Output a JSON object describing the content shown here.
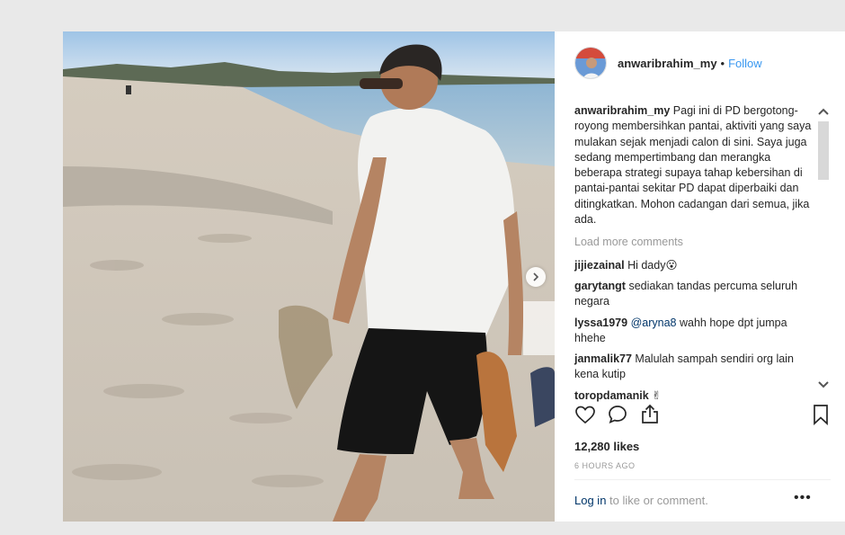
{
  "post": {
    "username": "anwaribrahim_my",
    "follow_label": "Follow",
    "separator": "•",
    "caption_user": "anwaribrahim_my",
    "caption_text": "Pagi ini di PD bergotong-royong membersihkan pantai, aktiviti yang saya mulakan sejak menjadi calon di sini. Saya juga sedang mempertimbang dan merangka beberapa strategi supaya tahap kebersihan di pantai-pantai sekitar PD dapat diperbaiki dan ditingkatkan. Mohon cadangan dari semua, jika ada.",
    "load_more": "Load more comments",
    "comments": [
      {
        "user": "jijiezainal",
        "text": "Hi dady😮"
      },
      {
        "user": "garytangt",
        "text": "sediakan tandas percuma seluruh negara"
      },
      {
        "user": "lyssa1979",
        "mention": "@aryna8",
        "text": "wahh hope dpt jumpa hhehe"
      },
      {
        "user": "janmalik77",
        "text": "Malulah sampah sendiri org lain kena kutip"
      },
      {
        "user": "toropdamanik",
        "text": "✌"
      }
    ],
    "likes": "12,280 likes",
    "time_ago": "6 HOURS AGO",
    "login_link": "Log in",
    "login_rest": " to like or comment.",
    "more_label": "•••"
  },
  "icons": {
    "heart": "heart-icon",
    "comment": "comment-icon",
    "share": "share-icon",
    "bookmark": "bookmark-icon"
  },
  "colors": {
    "link": "#3897f0",
    "muted": "#999999",
    "text": "#262626"
  }
}
